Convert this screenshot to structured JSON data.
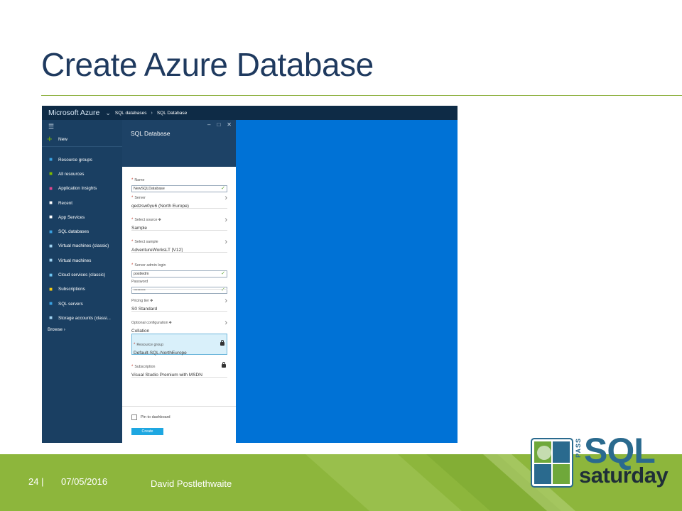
{
  "slide": {
    "title": "Create Azure Database",
    "page_number": "24 |",
    "date": "07/05/2016",
    "author": "David Postlethwaite"
  },
  "logo": {
    "pass": "PASS",
    "sql": "SQL",
    "saturday": "saturday"
  },
  "portal": {
    "brand": "Microsoft Azure",
    "breadcrumb": [
      "SQL databases",
      "SQL Database"
    ],
    "sidebar": {
      "new_label": "New",
      "items": [
        {
          "label": "Resource groups",
          "icon": "resource-groups-icon",
          "color": "#3aa0e0"
        },
        {
          "label": "All resources",
          "icon": "grid-icon",
          "color": "#7fba00"
        },
        {
          "label": "Application Insights",
          "icon": "lightbulb-icon",
          "color": "#e0448c"
        },
        {
          "label": "Recent",
          "icon": "clock-icon",
          "color": "#ffffff"
        },
        {
          "label": "App Services",
          "icon": "globe-icon",
          "color": "#ffffff"
        },
        {
          "label": "SQL databases",
          "icon": "database-icon",
          "color": "#3aa0e0"
        },
        {
          "label": "Virtual machines (classic)",
          "icon": "monitor-icon",
          "color": "#9fd3f2"
        },
        {
          "label": "Virtual machines",
          "icon": "monitor-icon",
          "color": "#9fd3f2"
        },
        {
          "label": "Cloud services (classic)",
          "icon": "cloud-icon",
          "color": "#6cc3f0"
        },
        {
          "label": "Subscriptions",
          "icon": "key-icon",
          "color": "#f2c811"
        },
        {
          "label": "SQL servers",
          "icon": "server-icon",
          "color": "#3aa0e0"
        },
        {
          "label": "Storage accounts (classi...",
          "icon": "storage-icon",
          "color": "#9fd3f2"
        }
      ],
      "browse_label": "Browse"
    },
    "blade": {
      "title": "SQL Database",
      "name_label": "Name",
      "name_value": "NewSQLDatabase",
      "server_label": "Server",
      "server_value": "qedzsw0yu6 (North Europe)",
      "source_label": "Select source",
      "source_value": "Sample",
      "sample_label": "Select sample",
      "sample_value": "AdventureWorksLT [V12]",
      "admin_label": "Server admin login",
      "admin_value": "postledm",
      "password_label": "Password",
      "password_value": "•••••••••",
      "pricing_label": "Pricing tier",
      "pricing_value": "S0 Standard",
      "optional_label": "Optional configuration",
      "optional_value": "Collation",
      "rg_label": "Resource group",
      "rg_value": "Default-SQL-NorthEurope",
      "sub_label": "Subscription",
      "sub_value": "Visual Studio Premium with MSDN",
      "pin_label": "Pin to dashboard",
      "create_label": "Create"
    }
  },
  "colors": {
    "title": "#1f3a5f",
    "accent_green": "#8db63c",
    "azure_blue": "#0072d6",
    "sidebar": "#1a3f62"
  }
}
